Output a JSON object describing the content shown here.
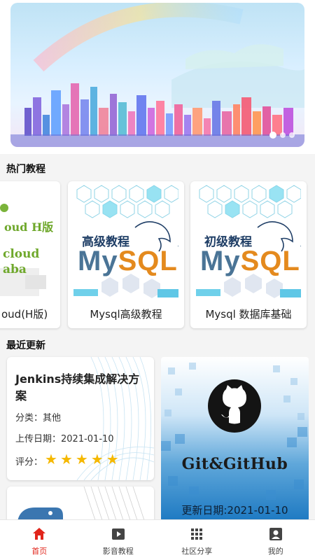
{
  "banner": {
    "dots": 3,
    "active_dot": 0
  },
  "hot": {
    "section_title": "热门教程",
    "cards": [
      {
        "label": "oud(H版)",
        "thumb_line1": "oud H版",
        "thumb_line2": "cloud",
        "thumb_line3": "aba"
      },
      {
        "label": "Mysql高级教程",
        "thumb_title": "高级教程",
        "thumb_my": "My",
        "thumb_sql": "SQL",
        "thumb_tm": "TM"
      },
      {
        "label": "Mysql 数据库基础",
        "thumb_title": "初级教程",
        "thumb_my": "My",
        "thumb_sql": "SQL",
        "thumb_tm": "TM"
      }
    ]
  },
  "recent": {
    "section_title": "最近更新",
    "jenkins": {
      "title": "Jenkins持续集成解决方案",
      "category_label": "分类：",
      "category_value": "其他",
      "date_label": "上传日期：",
      "date_value": "2021-01-10",
      "rating_label": "评分：",
      "rating": 5
    },
    "git": {
      "title": "Git&GitHub",
      "date": "更新日期:2021-01-10"
    }
  },
  "tabbar": {
    "active": 0,
    "items": [
      {
        "label": "首页",
        "icon": "home-icon"
      },
      {
        "label": "影音教程",
        "icon": "video-icon"
      },
      {
        "label": "社区分享",
        "icon": "grid-icon"
      },
      {
        "label": "我的",
        "icon": "profile-icon"
      }
    ]
  },
  "colors": {
    "accent": "#e1251b",
    "star": "#f5b800",
    "mysql_blue": "#4a7496",
    "mysql_orange": "#e48a1e"
  }
}
